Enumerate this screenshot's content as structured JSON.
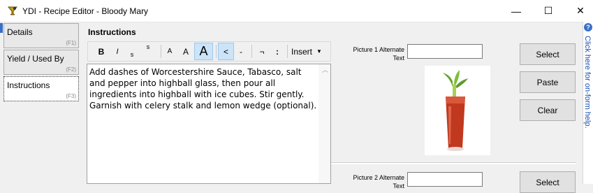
{
  "window": {
    "title": "YDI - Recipe Editor - Bloody Mary",
    "minimize_glyph": "—",
    "maximize_glyph": "☐",
    "close_glyph": "✕"
  },
  "tabs": [
    {
      "label": "Details",
      "key": "(F1)",
      "active": false
    },
    {
      "label": "Yield / Used By",
      "key": "(F2)",
      "active": false
    },
    {
      "label": "Instructions",
      "key": "(F3)",
      "active": true
    }
  ],
  "section_label": "Instructions",
  "toolbar": {
    "bold": "B",
    "italic": "I",
    "subscript": "s",
    "superscript": "s",
    "font_small": "A",
    "font_medium": "A",
    "font_large": "A",
    "less_than": "<",
    "dash": "-",
    "not": "¬",
    "colon": ":",
    "insert": "Insert",
    "insert_arrow": "▼"
  },
  "editor": {
    "text": "Add dashes of Worcestershire Sauce, Tabasco, salt and pepper into highball glass, then pour all ingredients into highball with ice cubes. Stir gently. Garnish with celery stalk and lemon wedge (optional)."
  },
  "picture1": {
    "label_line1": "Picture 1 Alternate",
    "label_line2": "Text",
    "value": "",
    "image_icon": "bloody-mary-photo"
  },
  "picture2": {
    "label_line1": "Picture 2 Alternate",
    "label_line2": "Text",
    "value": ""
  },
  "buttons": {
    "select": "Select",
    "paste": "Paste",
    "clear": "Clear",
    "select2": "Select"
  },
  "help": {
    "icon": "?",
    "text": "Click here for on-form help."
  },
  "colors": {
    "accent": "#3a6fc8",
    "pressed": "#cce4f7"
  }
}
